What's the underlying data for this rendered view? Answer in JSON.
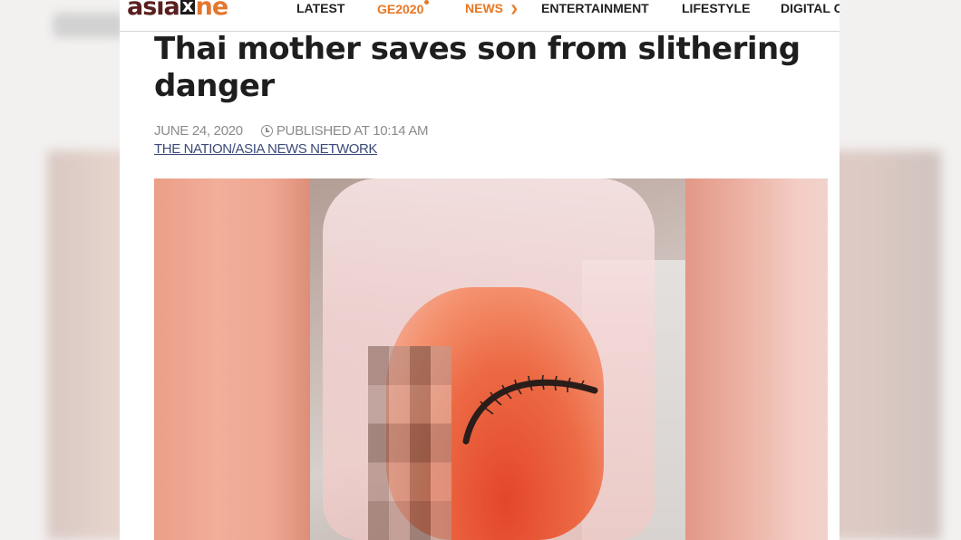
{
  "site": {
    "logo_part1": "asia",
    "logo_x": "x",
    "logo_part2": "ne"
  },
  "nav": {
    "items": [
      {
        "label": "LATEST"
      },
      {
        "label": "GE2020",
        "color": "#e87722"
      },
      {
        "label": "NEWS",
        "color": "#e87722"
      },
      {
        "label": "ENTERTAINMENT"
      },
      {
        "label": "LIFESTYLE"
      },
      {
        "label": "DIGITAL C"
      }
    ]
  },
  "article": {
    "headline": "Thai mother saves son from slithering danger",
    "date": "JUNE 24, 2020",
    "published": "PUBLISHED AT 10:14 AM",
    "source": "THE NATION/ASIA NEWS NETWORK"
  },
  "colors": {
    "accent": "#e87722",
    "logo_dark": "#5a1f1f",
    "headline": "#1e1e1e",
    "meta": "#8b8b8b",
    "source_link": "#3c4a7a"
  },
  "icons": {
    "clock": "clock-icon",
    "chevron": "chevron-down-icon"
  }
}
